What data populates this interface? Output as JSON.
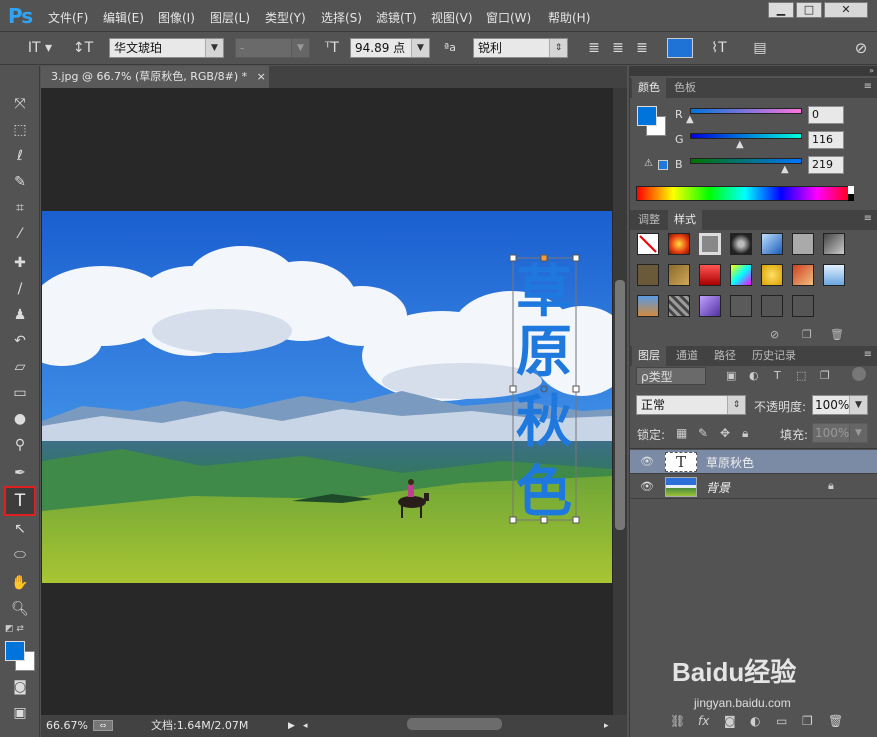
{
  "app": {
    "logo": "Ps"
  },
  "menubar": {
    "items": [
      "文件(F)",
      "编辑(E)",
      "图像(I)",
      "图层(L)",
      "类型(Y)",
      "选择(S)",
      "滤镜(T)",
      "视图(V)",
      "窗口(W)",
      "帮助(H)"
    ]
  },
  "window_controls": {
    "minimize": "▁",
    "maximize": "□",
    "close": "✕"
  },
  "options": {
    "font_family": "华文琥珀",
    "font_style": "-",
    "font_size": "94.89 点",
    "antialias": "锐利",
    "text_color": "#1f73d6"
  },
  "document": {
    "tab_title": "3.jpg @ 66.7% (草原秋色, RGB/8#) *",
    "tab_close": "×",
    "text_content": "草原秋色",
    "text_color": "#1e78de"
  },
  "statusbar": {
    "zoom": "66.67%",
    "doc_info": "文档:1.64M/2.07M"
  },
  "color_panel": {
    "tabs": [
      "颜色",
      "色板"
    ],
    "active_tab": "颜色",
    "channels": [
      {
        "label": "R",
        "value": "0"
      },
      {
        "label": "G",
        "value": "116"
      },
      {
        "label": "B",
        "value": "219"
      }
    ],
    "foreground": "#0074db",
    "background": "#ffffff"
  },
  "styles_panel": {
    "tabs": [
      "调整",
      "样式"
    ],
    "active_tab": "样式"
  },
  "layers_panel": {
    "tabs": [
      "图层",
      "通道",
      "路径",
      "历史记录"
    ],
    "active_tab": "图层",
    "filter_label": "ρ类型",
    "blend_mode": "正常",
    "opacity_label": "不透明度:",
    "opacity_value": "100%",
    "lock_label": "锁定:",
    "fill_label": "填充:",
    "fill_value": "100%",
    "layers": [
      {
        "name": "草原秋色",
        "type": "text",
        "selected": true,
        "thumb": "T"
      },
      {
        "name": "背景",
        "type": "image",
        "selected": false,
        "locked": true
      }
    ]
  },
  "watermark": {
    "brand": "Baidu经验",
    "url": "jingyan.baidu.com"
  }
}
